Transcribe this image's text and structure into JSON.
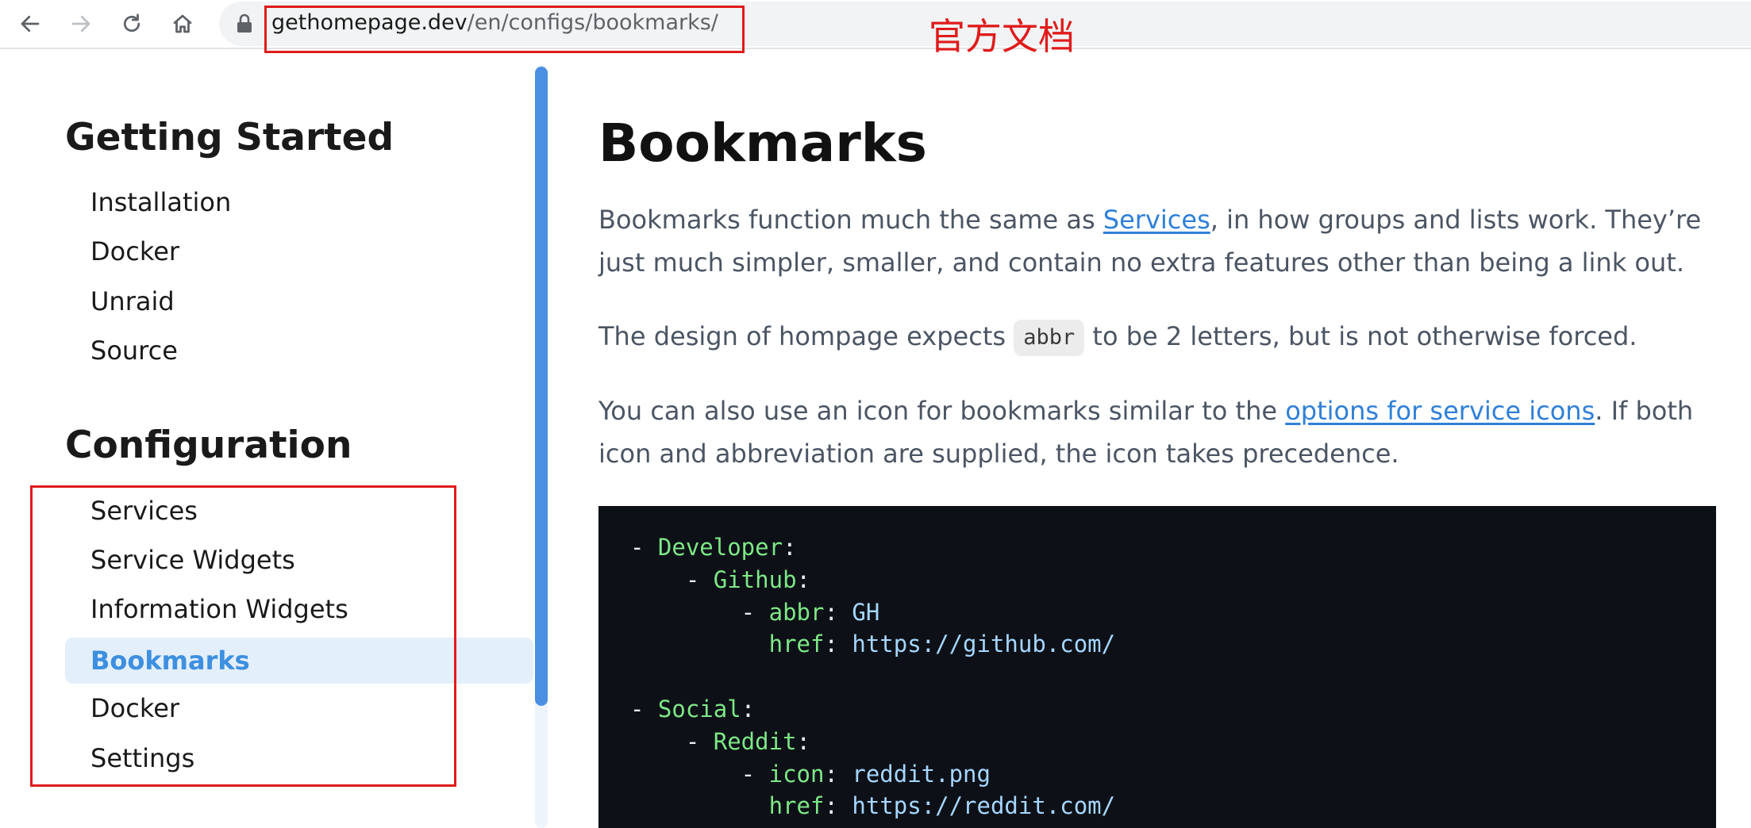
{
  "browser": {
    "url_host": "gethomepage.dev",
    "url_path": "/en/configs/bookmarks/",
    "annotation": "官方文档"
  },
  "sidebar": {
    "sections": [
      {
        "title": "Getting Started",
        "items": [
          "Installation",
          "Docker",
          "Unraid",
          "Source"
        ]
      },
      {
        "title": "Configuration",
        "items": [
          "Services",
          "Service Widgets",
          "Information Widgets",
          "Bookmarks",
          "Docker",
          "Settings"
        ]
      }
    ],
    "active_item": "Bookmarks"
  },
  "main": {
    "title": "Bookmarks",
    "p1_before": "Bookmarks function much the same as ",
    "p1_link": "Services",
    "p1_after": ", in how groups and lists work. They’re just much simpler, smaller, and contain no extra features other than being a link out.",
    "p2_before": "The design of hompage expects ",
    "p2_code": "abbr",
    "p2_after": " to be 2 letters, but is not otherwise forced.",
    "p3_before": "You can also use an icon for bookmarks similar to the ",
    "p3_link": "options for service icons",
    "p3_after": ". If both icon and abbreviation are supplied, the icon takes precedence.",
    "code_lines": [
      [
        "- ",
        "Developer",
        ":",
        ""
      ],
      [
        "    - ",
        "Github",
        ":",
        ""
      ],
      [
        "        - ",
        "abbr",
        ": ",
        "GH"
      ],
      [
        "          ",
        "href",
        ": ",
        "https://github.com/"
      ],
      [
        "",
        "",
        "",
        ""
      ],
      [
        "- ",
        "Social",
        ":",
        ""
      ],
      [
        "    - ",
        "Reddit",
        ":",
        ""
      ],
      [
        "        - ",
        "icon",
        ": ",
        "reddit.png"
      ],
      [
        "          ",
        "href",
        ": ",
        "https://reddit.com/"
      ]
    ]
  },
  "colors": {
    "accent": "#3d8fe0",
    "link": "#2f80d8",
    "annotation_red": "#e01b1b",
    "code_bg": "#0d1117",
    "code_key": "#7ee787",
    "code_value": "#a5d6ff"
  }
}
